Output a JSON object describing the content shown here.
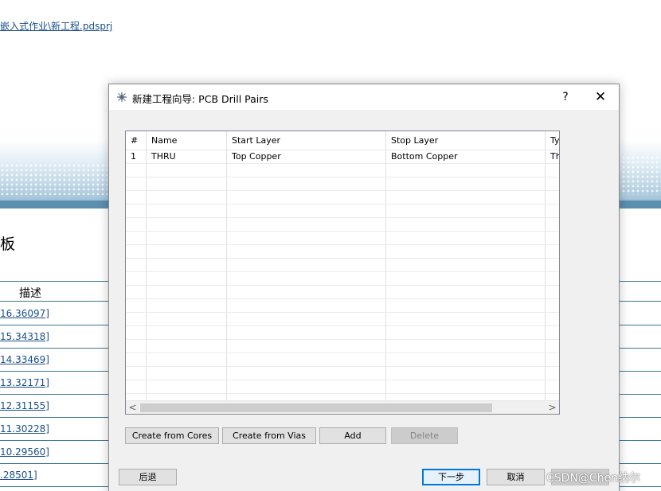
{
  "background": {
    "path_link": "嵌入式作业\\新工程.pdsprj",
    "heading": "板",
    "column_header": "描述",
    "rows": [
      "16.36097]",
      "15.34318]",
      "14.33469]",
      "13.32171]",
      "12.31155]",
      "11.30228]",
      "10.29560]",
      ".28501]"
    ]
  },
  "dialog": {
    "title": "新建工程向导: PCB Drill Pairs",
    "help_label": "?",
    "close_label": "✕",
    "grid": {
      "columns": [
        "#",
        "Name",
        "Start Layer",
        "Stop Layer",
        "Ty"
      ],
      "rows": [
        [
          "1",
          "THRU",
          "Top Copper",
          "Bottom Copper",
          "Th"
        ]
      ]
    },
    "scroll_left": "<",
    "scroll_right": ">",
    "buttons": {
      "create_from_cores": "Create from Cores",
      "create_from_vias": "Create from Vias",
      "add": "Add",
      "delete": "Delete",
      "back": "后退",
      "next": "下一步",
      "cancel": "取消"
    }
  },
  "watermark": "CSDN@Chen纳尔",
  "colors": {
    "link": "#1a4f8c",
    "table_border": "#3d7799",
    "dialog_bg": "#f0f0f0",
    "default_button_border": "#0078d7"
  }
}
